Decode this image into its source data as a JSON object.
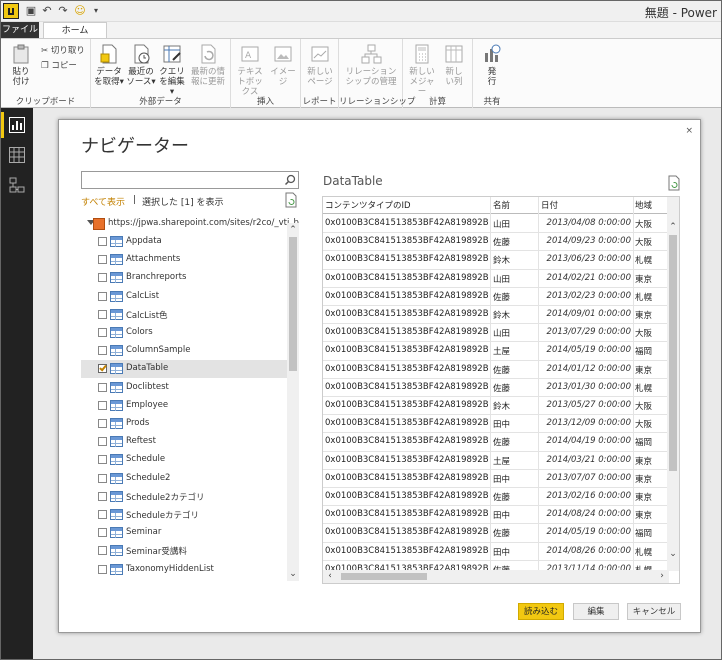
{
  "window": {
    "title": "無題 - Power"
  },
  "tabs": [
    {
      "label": "ファイル"
    },
    {
      "label": "ホーム"
    }
  ],
  "ribbon": {
    "clipboard": {
      "label": "クリップボード",
      "paste": "貼り付け",
      "cut": "切り取り",
      "copy": "コピー"
    },
    "external_data": {
      "label": "外部データ",
      "get_data": "データを取得▾",
      "recent_sources": "最近のソース▾",
      "edit_queries": "クエリを編集▾",
      "refresh": "最新の情報に更新"
    },
    "insert": {
      "label": "挿入",
      "textbox": "テキストボックス",
      "image": "イメージ"
    },
    "report": {
      "label": "レポート",
      "new_page": "新しいページ"
    },
    "relationships": {
      "label": "リレーションシップ",
      "manage": "リレーションシップの管理"
    },
    "calculations": {
      "label": "計算",
      "new_measure": "新しいメジャー",
      "new_column": "新しい列"
    },
    "share": {
      "label": "共有",
      "publish": "発行"
    }
  },
  "dialog": {
    "title": "ナビゲーター",
    "close": "×",
    "search": {
      "value": "",
      "placeholder": ""
    },
    "show_all": "すべて表示",
    "separator": "|",
    "show_selected": "選択した [1] を表示",
    "root": "https://jpwa.sharepoint.com/sites/r2co/_vti_b...",
    "items": [
      {
        "label": "Appdata",
        "checked": false
      },
      {
        "label": "Attachments",
        "checked": false
      },
      {
        "label": "Branchreports",
        "checked": false
      },
      {
        "label": "CalcList",
        "checked": false
      },
      {
        "label": "CalcList色",
        "checked": false
      },
      {
        "label": "Colors",
        "checked": false
      },
      {
        "label": "ColumnSample",
        "checked": false
      },
      {
        "label": "DataTable",
        "checked": true
      },
      {
        "label": "Doclibtest",
        "checked": false
      },
      {
        "label": "Employee",
        "checked": false
      },
      {
        "label": "Prods",
        "checked": false
      },
      {
        "label": "Reftest",
        "checked": false
      },
      {
        "label": "Schedule",
        "checked": false
      },
      {
        "label": "Schedule2",
        "checked": false
      },
      {
        "label": "Schedule2カテゴリ",
        "checked": false
      },
      {
        "label": "Scheduleカテゴリ",
        "checked": false
      },
      {
        "label": "Seminar",
        "checked": false
      },
      {
        "label": "Seminar受講料",
        "checked": false
      },
      {
        "label": "TaxonomyHiddenList",
        "checked": false
      }
    ],
    "preview": {
      "title": "DataTable",
      "columns": [
        "コンテンツタイプのID",
        "名前",
        "日付",
        "地域"
      ],
      "rows": [
        [
          "0x0100B3C841513853BF42A819892B8EAD2A…",
          "山田",
          "2013/04/08 0:00:00",
          "大阪"
        ],
        [
          "0x0100B3C841513853BF42A819892B8EAD2A…",
          "佐藤",
          "2014/09/23 0:00:00",
          "大阪"
        ],
        [
          "0x0100B3C841513853BF42A819892B8EAD2A…",
          "鈴木",
          "2013/06/23 0:00:00",
          "札幌"
        ],
        [
          "0x0100B3C841513853BF42A819892B8EAD2A…",
          "山田",
          "2014/02/21 0:00:00",
          "東京"
        ],
        [
          "0x0100B3C841513853BF42A819892B8EAD2A…",
          "佐藤",
          "2013/02/23 0:00:00",
          "札幌"
        ],
        [
          "0x0100B3C841513853BF42A819892B8EAD2A…",
          "鈴木",
          "2014/09/01 0:00:00",
          "東京"
        ],
        [
          "0x0100B3C841513853BF42A819892B8EAD2A…",
          "山田",
          "2013/07/29 0:00:00",
          "大阪"
        ],
        [
          "0x0100B3C841513853BF42A819892B8EAD2A…",
          "土屋",
          "2014/05/19 0:00:00",
          "福岡"
        ],
        [
          "0x0100B3C841513853BF42A819892B8EAD2A…",
          "佐藤",
          "2014/01/12 0:00:00",
          "東京"
        ],
        [
          "0x0100B3C841513853BF42A819892B8EAD2A…",
          "佐藤",
          "2013/01/30 0:00:00",
          "札幌"
        ],
        [
          "0x0100B3C841513853BF42A819892B8EAD2A…",
          "鈴木",
          "2013/05/27 0:00:00",
          "大阪"
        ],
        [
          "0x0100B3C841513853BF42A819892B8EAD2A…",
          "田中",
          "2013/12/09 0:00:00",
          "大阪"
        ],
        [
          "0x0100B3C841513853BF42A819892B8EAD2A…",
          "佐藤",
          "2014/04/19 0:00:00",
          "福岡"
        ],
        [
          "0x0100B3C841513853BF42A819892B8EAD2A…",
          "土屋",
          "2014/03/21 0:00:00",
          "東京"
        ],
        [
          "0x0100B3C841513853BF42A819892B8EAD2A…",
          "田中",
          "2013/07/07 0:00:00",
          "東京"
        ],
        [
          "0x0100B3C841513853BF42A819892B8EAD2A…",
          "佐藤",
          "2013/02/16 0:00:00",
          "東京"
        ],
        [
          "0x0100B3C841513853BF42A819892B8EAD2A…",
          "田中",
          "2014/08/24 0:00:00",
          "東京"
        ],
        [
          "0x0100B3C841513853BF42A819892B8EAD2A…",
          "佐藤",
          "2014/05/19 0:00:00",
          "福岡"
        ],
        [
          "0x0100B3C841513853BF42A819892B8EAD2A…",
          "田中",
          "2014/08/26 0:00:00",
          "札幌"
        ],
        [
          "0x0100B3C841513853BF42A819892B8EAD2A…",
          "佐藤",
          "2013/11/14 0:00:00",
          "札幌"
        ],
        [
          "0x0100B3C841513853BF42A819892B8EAD2A…",
          "田中",
          "2013/03/29 0:00:00",
          "札幌"
        ],
        [
          "0x0100B3C841513853BF42A819892B8EAD2A…",
          "山田",
          "2013/08/06 0:00:00",
          "札幌"
        ],
        [
          "0x0100B3C841513853BF42A819892B8EAD2A…",
          "山田",
          "2014/07/24 0:00:00",
          "札幌"
        ]
      ]
    },
    "buttons": {
      "load": "読み込む",
      "edit": "編集",
      "cancel": "キャンセル"
    }
  },
  "colors": {
    "accent": "#f2c811",
    "link": "#c28000",
    "nav": "#222222"
  }
}
